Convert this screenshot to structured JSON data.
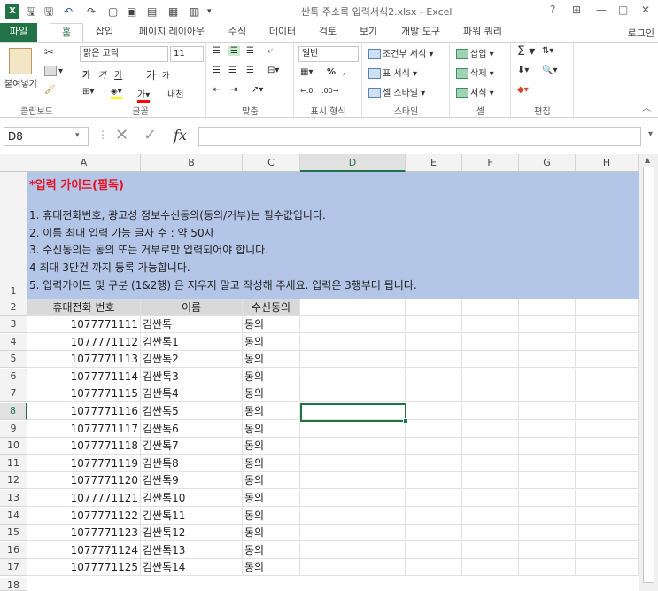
{
  "titlebar": {
    "app_logo": "X",
    "title": "싼톡 주소록 입력서식2.xlsx - Excel",
    "help": "?",
    "ribbon_display": "⊞",
    "minimize": "—",
    "maximize": "□",
    "close": "✕"
  },
  "tabs": [
    "파일",
    "홈",
    "삽입",
    "페이지 레이아웃",
    "수식",
    "데이터",
    "검토",
    "보기",
    "개발 도구",
    "파워 쿼리"
  ],
  "login": "로그인",
  "ribbon": {
    "clipboard": {
      "paste": "붙여넣기",
      "label": "클립보드"
    },
    "font": {
      "name": "맑은 고딕",
      "size": "11",
      "label": "글꼴",
      "bold": "가",
      "italic": "가",
      "underline": "가",
      "grow": "가",
      "shrink": "가",
      "phonetic": "내천"
    },
    "alignment": {
      "label": "맞춤"
    },
    "number": {
      "format": "일반",
      "percent": "%",
      "label": "표시 형식"
    },
    "styles": {
      "conditional": "조건부 서식",
      "table": "표 서식",
      "cell": "셀 스타일",
      "label": "스타일"
    },
    "cells": {
      "insert": "삽입",
      "delete": "삭제",
      "format": "서식",
      "label": "셀"
    },
    "editing": {
      "label": "편집"
    }
  },
  "formula_bar": {
    "name_box": "D8",
    "fx": "fx",
    "value": ""
  },
  "columns": [
    "A",
    "B",
    "C",
    "D",
    "E",
    "F",
    "G",
    "H"
  ],
  "guide": {
    "title": "*입력 가이드(필독)",
    "lines": [
      "1. 휴대전화번호, 광고성 정보수신동의(동의/거부)는 필수값입니다.",
      "2. 이름 최대 입력 가능 글자 수 :  약 50자",
      "3. 수신동의는 동의 또는 거부로만 입력되어야 합니다.",
      "4 최대 3만건 까지 등록 가능합니다.",
      "5. 입력가이드 및 구분 (1&2행) 은 지우지 말고 작성해 주세요. 입력은 3행부터 됩니다."
    ]
  },
  "header_row": [
    "휴대전화 번호",
    "이름",
    "수신동의"
  ],
  "rows": [
    {
      "n": "3",
      "phone": "1077771111",
      "name": "김싼톡",
      "consent": "동의"
    },
    {
      "n": "4",
      "phone": "1077771112",
      "name": "김싼톡1",
      "consent": "동의"
    },
    {
      "n": "5",
      "phone": "1077771113",
      "name": "김싼톡2",
      "consent": "동의"
    },
    {
      "n": "6",
      "phone": "1077771114",
      "name": "김싼톡3",
      "consent": "동의"
    },
    {
      "n": "7",
      "phone": "1077771115",
      "name": "김싼톡4",
      "consent": "동의"
    },
    {
      "n": "8",
      "phone": "1077771116",
      "name": "김싼톡5",
      "consent": "동의"
    },
    {
      "n": "9",
      "phone": "1077771117",
      "name": "김싼톡6",
      "consent": "동의"
    },
    {
      "n": "10",
      "phone": "1077771118",
      "name": "김싼톡7",
      "consent": "동의"
    },
    {
      "n": "11",
      "phone": "1077771119",
      "name": "김싼톡8",
      "consent": "동의"
    },
    {
      "n": "12",
      "phone": "1077771120",
      "name": "김싼톡9",
      "consent": "동의"
    },
    {
      "n": "13",
      "phone": "1077771121",
      "name": "김싼톡10",
      "consent": "동의"
    },
    {
      "n": "14",
      "phone": "1077771122",
      "name": "김싼톡11",
      "consent": "동의"
    },
    {
      "n": "15",
      "phone": "1077771123",
      "name": "김싼톡12",
      "consent": "동의"
    },
    {
      "n": "16",
      "phone": "1077771124",
      "name": "김싼톡13",
      "consent": "동의"
    },
    {
      "n": "17",
      "phone": "1077771125",
      "name": "김싼톡14",
      "consent": "동의"
    }
  ],
  "row_numbers": [
    "1",
    "2",
    "18"
  ],
  "colors": {
    "excel_green": "#217346",
    "guide_fill": "#b4c6e7",
    "header_fill": "#d9d9d9",
    "guide_title": "#e81123"
  }
}
